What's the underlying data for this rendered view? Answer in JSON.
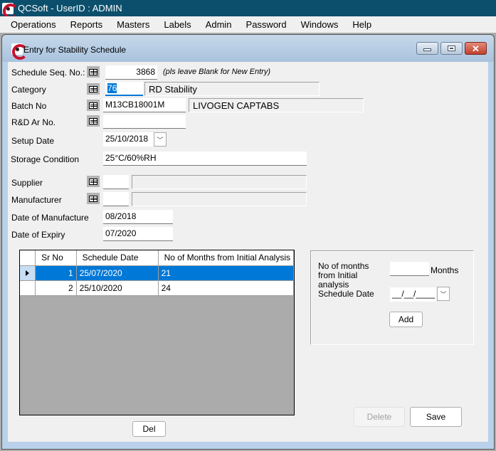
{
  "app": {
    "title": "QCSoft - UserID : ADMIN"
  },
  "menu": [
    "Operations",
    "Reports",
    "Masters",
    "Labels",
    "Admin",
    "Password",
    "Windows",
    "Help"
  ],
  "form": {
    "title": "Entry for Stability Schedule",
    "schedule_seq": {
      "label": "Schedule Seq. No.:",
      "value": "3868",
      "hint": "(pls leave Blank for New Entry)"
    },
    "category": {
      "label": "Category",
      "code": "76",
      "name": "RD Stability"
    },
    "batch": {
      "label": "Batch No",
      "code": "M13CB18001M",
      "name": "LIVOGEN CAPTABS"
    },
    "rd_ar": {
      "label": "R&D Ar No.",
      "value": ""
    },
    "setup_date": {
      "label": "Setup Date",
      "value": "25/10/2018"
    },
    "storage": {
      "label": "Storage Condition",
      "value": "25°C/60%RH"
    },
    "supplier": {
      "label": "Supplier",
      "code": "",
      "name": ""
    },
    "manufacturer": {
      "label": "Manufacturer",
      "code": "",
      "name": ""
    },
    "mfg_date": {
      "label": "Date of Manufacture",
      "value": "08/2018"
    },
    "exp_date": {
      "label": "Date of Expiry",
      "value": "07/2020"
    }
  },
  "grid": {
    "columns": [
      "Sr No",
      "Schedule Date",
      "No of Months from Initial Analysis"
    ],
    "rows": [
      {
        "sr": "1",
        "date": "25/07/2020",
        "months": "21",
        "selected": true
      },
      {
        "sr": "2",
        "date": "25/10/2020",
        "months": "24",
        "selected": false
      }
    ],
    "del_label": "Del"
  },
  "add_panel": {
    "months_label": "No of months from Initial analysis",
    "months_value": "",
    "months_unit": "Months",
    "date_label": "Schedule Date",
    "date_value": "__/__/____",
    "add_label": "Add"
  },
  "actions": {
    "delete_label": "Delete",
    "save_label": "Save"
  },
  "colors": {
    "titlebar": "#0b4f6c",
    "selection": "#0078d7",
    "grid_bg": "#ababab"
  }
}
